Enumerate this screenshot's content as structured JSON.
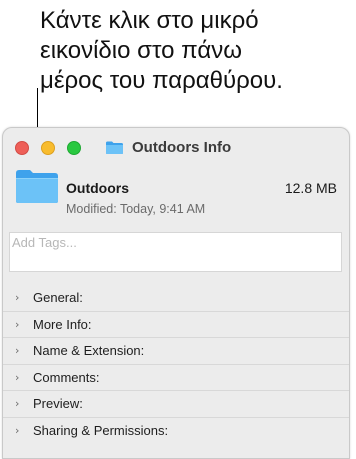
{
  "callout": {
    "line1": "Κάντε κλικ στο μικρό",
    "line2": "εικονίδιο στο πάνω",
    "line3": "μέρος του παραθύρου."
  },
  "window": {
    "title": "Outdoors Info",
    "title_icon": "folder-icon",
    "traffic_lights": {
      "close_color": "#ee5f58",
      "minimize_color": "#f8bc2e",
      "zoom_color": "#29c840"
    }
  },
  "item": {
    "name": "Outdoors",
    "size": "12.8 MB",
    "modified": "Modified: Today, 9:41 AM",
    "icon": "folder-icon",
    "folder_color": "#5bb8f5"
  },
  "tags": {
    "placeholder": "Add Tags..."
  },
  "sections": [
    {
      "label": "General:"
    },
    {
      "label": "More Info:"
    },
    {
      "label": "Name & Extension:"
    },
    {
      "label": "Comments:"
    },
    {
      "label": "Preview:"
    },
    {
      "label": "Sharing & Permissions:"
    }
  ],
  "chevron_glyph": "›"
}
